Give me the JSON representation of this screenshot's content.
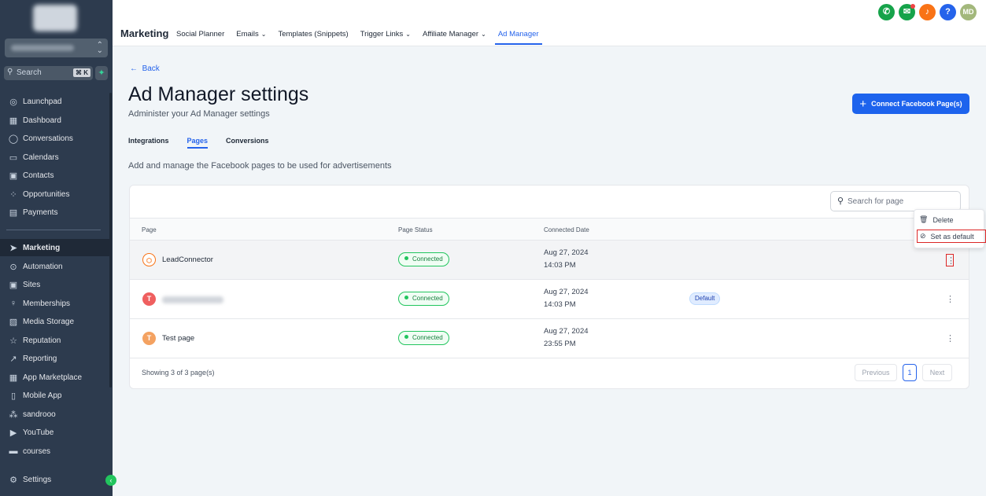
{
  "colors": {
    "sidebar_bg": "#2d3b4e",
    "accent": "#2563eb",
    "success": "#22c55e",
    "highlight": "#dc2626"
  },
  "sidebar": {
    "search_placeholder": "Search",
    "search_shortcut": "⌘ K",
    "items": [
      {
        "label": "Launchpad",
        "icon": "rocket-icon"
      },
      {
        "label": "Dashboard",
        "icon": "grid-icon"
      },
      {
        "label": "Conversations",
        "icon": "chat-icon"
      },
      {
        "label": "Calendars",
        "icon": "calendar-icon"
      },
      {
        "label": "Contacts",
        "icon": "contacts-icon"
      },
      {
        "label": "Opportunities",
        "icon": "opportunities-icon"
      },
      {
        "label": "Payments",
        "icon": "payments-icon"
      },
      {
        "label": "Marketing",
        "icon": "send-icon"
      },
      {
        "label": "Automation",
        "icon": "automation-icon"
      },
      {
        "label": "Sites",
        "icon": "sites-icon"
      },
      {
        "label": "Memberships",
        "icon": "memberships-icon"
      },
      {
        "label": "Media Storage",
        "icon": "image-icon"
      },
      {
        "label": "Reputation",
        "icon": "star-icon"
      },
      {
        "label": "Reporting",
        "icon": "trend-icon"
      },
      {
        "label": "App Marketplace",
        "icon": "apps-icon"
      },
      {
        "label": "Mobile App",
        "icon": "mobile-icon"
      },
      {
        "label": "sandrooo",
        "icon": "custom-icon"
      },
      {
        "label": "YouTube",
        "icon": "youtube-icon"
      },
      {
        "label": "courses",
        "icon": "courses-icon"
      }
    ],
    "settings_label": "Settings"
  },
  "header": {
    "brand": "Marketing",
    "tabs": [
      {
        "label": "Social Planner",
        "dropdown": false
      },
      {
        "label": "Emails",
        "dropdown": true
      },
      {
        "label": "Templates (Snippets)",
        "dropdown": false
      },
      {
        "label": "Trigger Links",
        "dropdown": true
      },
      {
        "label": "Affiliate Manager",
        "dropdown": true
      },
      {
        "label": "Ad Manager",
        "dropdown": false
      }
    ],
    "avatar_initials": "MD"
  },
  "page": {
    "back_label": "Back",
    "title": "Ad Manager settings",
    "subtitle": "Administer your Ad Manager settings",
    "connect_button": "Connect Facebook Page(s)",
    "subtabs": [
      "Integrations",
      "Pages",
      "Conversions"
    ],
    "description": "Add and manage the Facebook pages to be used for advertisements"
  },
  "table": {
    "search_placeholder": "Search for page",
    "columns": [
      "Page",
      "Page Status",
      "Connected Date"
    ],
    "rows": [
      {
        "initial": "",
        "name": "LeadConnector",
        "status": "Connected",
        "date": "Aug 27, 2024",
        "time": "14:03 PM",
        "badge": ""
      },
      {
        "initial": "T",
        "name": "",
        "status": "Connected",
        "date": "Aug 27, 2024",
        "time": "14:03 PM",
        "badge": "Default"
      },
      {
        "initial": "T",
        "name": "Test page",
        "status": "Connected",
        "date": "Aug 27, 2024",
        "time": "23:55 PM",
        "badge": ""
      }
    ],
    "footer": "Showing 3 of 3 page(s)",
    "pagination": {
      "previous": "Previous",
      "page": "1",
      "next": "Next"
    }
  },
  "menu": {
    "items": [
      "Delete",
      "Set as default"
    ]
  }
}
